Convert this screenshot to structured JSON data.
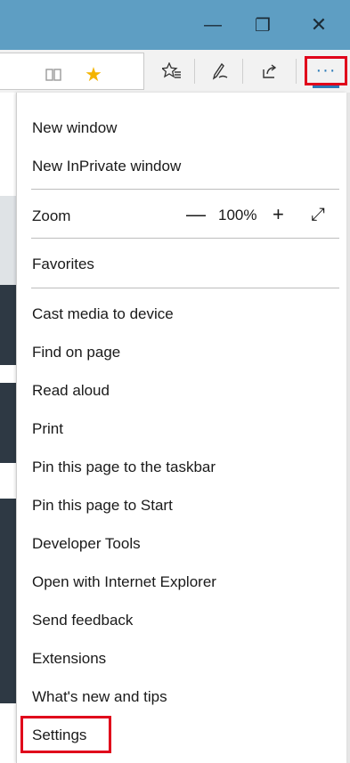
{
  "window": {
    "minimize_icon": "—",
    "restore_icon": "❐",
    "close_icon": "✕"
  },
  "toolbar": {
    "reading_view_icon": "reading-view-icon",
    "favorite_icon": "star-icon",
    "hub_icon": "favorites-hub-icon",
    "notes_icon": "pen-icon",
    "share_icon": "share-icon",
    "more_label": "···",
    "accent_color": "#e0001b"
  },
  "menu": {
    "new_window": "New window",
    "new_inprivate": "New InPrivate window",
    "zoom_label": "Zoom",
    "zoom_minus": "—",
    "zoom_value": "100%",
    "zoom_plus": "+",
    "zoom_fullscreen": "⤢",
    "favorites": "Favorites",
    "cast": "Cast media to device",
    "find": "Find on page",
    "read_aloud": "Read aloud",
    "print": "Print",
    "pin_taskbar": "Pin this page to the taskbar",
    "pin_start": "Pin this page to Start",
    "dev_tools": "Developer Tools",
    "open_ie": "Open with Internet Explorer",
    "send_feedback": "Send feedback",
    "extensions": "Extensions",
    "whats_new": "What's new and tips",
    "settings": "Settings"
  }
}
